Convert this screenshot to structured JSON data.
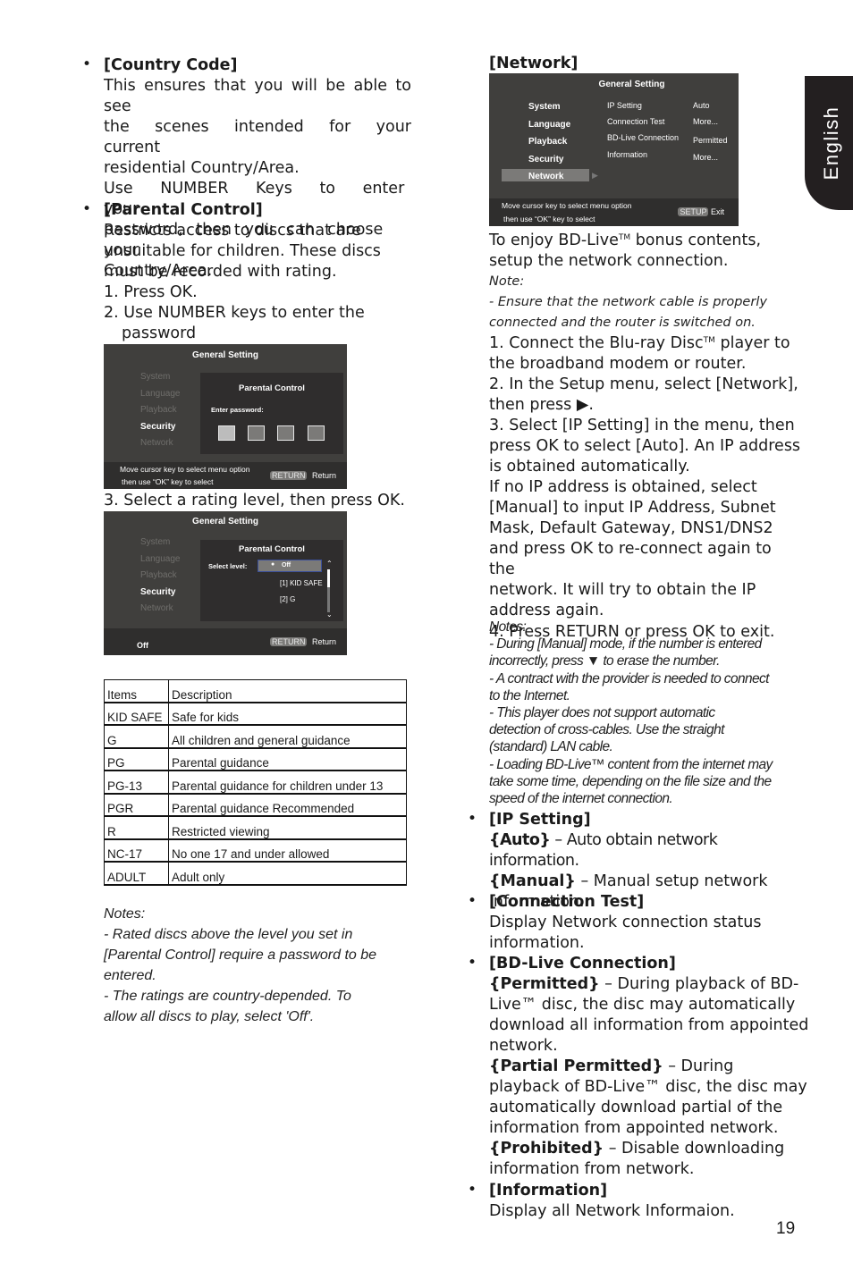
{
  "left": {
    "country_code": {
      "heading": "[Country Code]",
      "p1": [
        "This ensures that you will be able to see",
        "the scenes intended for your current",
        "residential Country/Area."
      ],
      "p2": [
        "Use NUMBER Keys to enter your",
        "password, then you can choose your",
        "Country/Area."
      ]
    },
    "parental_control": {
      "heading": "[Parental Control]",
      "lines": [
        "Restricts access to discs that are",
        "unsuitable for children. These discs",
        "must be recorded with rating."
      ],
      "step1": "1. Press OK.",
      "step2a": "2. Use NUMBER keys to enter the",
      "step2b": "password",
      "step3": "3. Select a rating level, then press OK."
    },
    "screen1": {
      "title": "General Setting",
      "menu": [
        "System",
        "Language",
        "Playback",
        "Security",
        "Network"
      ],
      "popup_title": "Parental Control",
      "prompt": "Enter password:",
      "footer_line1": "Move cursor key to select menu option",
      "footer_line2": "then use “OK” key to select",
      "footer_button": "RETURN",
      "footer_action": "Return"
    },
    "screen2": {
      "title": "General Setting",
      "menu": [
        "System",
        "Language",
        "Playback",
        "Security",
        "Network"
      ],
      "popup_title": "Parental Control",
      "prompt": "Select level:",
      "selected_option": "Off",
      "options": [
        "[1] KID SAFE",
        "[2] G"
      ],
      "footer_status": "Off",
      "footer_button": "RETURN",
      "footer_action": "Return"
    },
    "ratings_table": {
      "headers": [
        "Items",
        "Description"
      ],
      "rows": [
        [
          "KID SAFE",
          "Safe for kids"
        ],
        [
          "G",
          "All children and general guidance"
        ],
        [
          "PG",
          "Parental guidance"
        ],
        [
          "PG-13",
          "Parental guidance for children under 13"
        ],
        [
          "PGR",
          "Parental guidance Recommended"
        ],
        [
          "R",
          "Restricted viewing"
        ],
        [
          "NC-17",
          "No one 17 and under allowed"
        ],
        [
          "ADULT",
          "Adult only"
        ]
      ]
    },
    "notes": [
      "Notes:",
      "- Rated discs above the level you set in",
      "[Parental Control] require a password to be",
      "entered.",
      "- The ratings are country-depended. To",
      "allow all discs to play, select 'Off'."
    ]
  },
  "right": {
    "network_heading": "[Network]",
    "screen3": {
      "title": "General Setting",
      "menu": [
        "System",
        "Language",
        "Playback",
        "Security",
        "Network"
      ],
      "items": [
        {
          "label": "IP Setting",
          "value": "Auto"
        },
        {
          "label": "Connection Test",
          "value": "More..."
        },
        {
          "label": "BD-Live Connection",
          "value": "Permitted"
        },
        {
          "label": "Information",
          "value": "More..."
        }
      ],
      "footer_line1": "Move cursor key to select menu option",
      "footer_line2": "then use “OK” key to select",
      "footer_button": "SETUP",
      "footer_action": "Exit"
    },
    "intro_a": "To enjoy BD-Live",
    "tm": "TM",
    "intro_b": " bonus contents,",
    "intro_c": "setup the network connection.",
    "note1": [
      "Note:",
      "- Ensure that the network cable is properly",
      "connected and the router is switched on."
    ],
    "step1a": "1. Connect the Blu-ray Disc",
    "step1b": " player to",
    "step1c": "the broadband modem or router.",
    "step2a": "2. In the Setup menu, select [Network],",
    "step2b": "then press ▶.",
    "step3": [
      "3. Select [IP Setting] in the menu, then",
      "press OK to select [Auto]. An IP address",
      "is obtained automatically.",
      "If no IP address is obtained, select",
      "[Manual] to input IP Address, Subnet",
      "Mask, Default Gateway, DNS1/DNS2",
      "and press OK to re-connect again to the",
      "network. It will try to obtain the IP",
      "address again."
    ],
    "step4": "4. Press RETURN or press OK to exit.",
    "notes2": [
      "Notes:",
      "- During [Manual] mode, if the number is entered",
      "incorrectly, press ▼ to erase the number.",
      "- A contract with the provider is needed to connect",
      "to the Internet.",
      "- This player does not support automatic",
      "detection of cross-cables. Use the straight",
      "(standard) LAN cable.",
      "- Loading BD-Live™ content from the internet may",
      "take some time, depending on the file size and the",
      "speed of the internet connection."
    ],
    "ip_setting": {
      "heading": "[IP Setting]",
      "auto_key": "{Auto}",
      "auto_text": " – Auto obtain network information.",
      "manual_key": "{Manual}",
      "manual_text": " – Manual setup network",
      "manual_text2": "information."
    },
    "connection_test": {
      "heading": "[Connection Test]",
      "lines": [
        "Display Network connection status",
        "information."
      ]
    },
    "bd_live": {
      "heading": "[BD-Live Connection]",
      "permitted_key": "{Permitted}",
      "permitted_text": " – During playback of BD-",
      "permitted_lines": [
        "Live™ disc, the disc may automatically",
        "download all information from appointed",
        "network."
      ],
      "partial_key": "{Partial Permitted}",
      "partial_text": " – During",
      "partial_lines": [
        "playback of BD-Live™ disc, the disc may",
        "automatically download partial of the",
        "information from appointed network."
      ],
      "prohibited_key": "{Prohibited}",
      "prohibited_text": " – Disable downloading",
      "prohibited_lines": [
        "information from network."
      ]
    },
    "information": {
      "heading": "[Information]",
      "line": "Display all Network Informaion."
    }
  },
  "language_tab": "English",
  "page_number": "19"
}
